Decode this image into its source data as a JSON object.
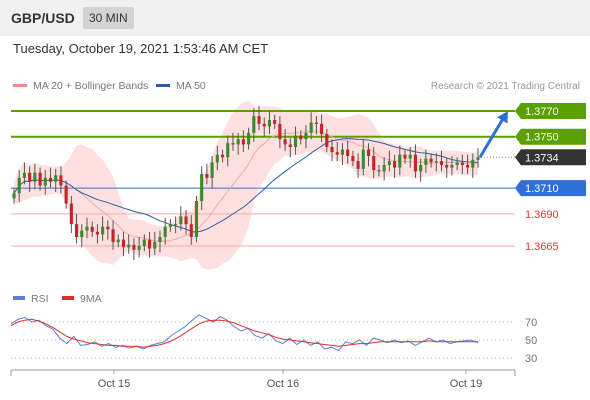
{
  "header": {
    "pair": "GBP/USD",
    "timeframe": "30 MIN"
  },
  "datetime": "Tuesday, October 19, 2021 1:53:46 AM CET",
  "legend": {
    "bollinger": {
      "label": "MA 20 + Bollinger Bands",
      "color": "#f08a8a"
    },
    "ma50": {
      "label": "MA 50",
      "color": "#2f5d9e"
    },
    "credit": "Research © 2021 Trading Central"
  },
  "rsi_legend": {
    "rsi": {
      "label": "RSI",
      "color": "#5b7fd6"
    },
    "ma9": {
      "label": "9MA",
      "color": "#e0302f"
    }
  },
  "chart_data": [
    {
      "type": "candlestick",
      "x_ticks": [
        "Oct 15",
        "Oct 16",
        "Oct 19"
      ],
      "last_price": 1.3734,
      "levels": [
        {
          "value": 1.377,
          "label": "1.3770",
          "kind": "resistance",
          "color": "#5aa000"
        },
        {
          "value": 1.375,
          "label": "1.3750",
          "kind": "resistance",
          "color": "#5aa000"
        },
        {
          "value": 1.3734,
          "label": "1.3734",
          "kind": "current",
          "color": "#333333"
        },
        {
          "value": 1.371,
          "label": "1.3710",
          "kind": "pivot",
          "color": "#2e6fd8"
        },
        {
          "value": 1.369,
          "label": "1.3690",
          "kind": "support",
          "color": "#e53935"
        },
        {
          "value": 1.3665,
          "label": "1.3665",
          "kind": "support",
          "color": "#e53935"
        }
      ],
      "projection": {
        "from": 1.3734,
        "to": 1.377,
        "color": "#2e6fd8"
      },
      "closes": [
        1.3706,
        1.3718,
        1.3722,
        1.3715,
        1.3722,
        1.3712,
        1.3718,
        1.3715,
        1.372,
        1.3712,
        1.3698,
        1.3682,
        1.3672,
        1.3677,
        1.368,
        1.3676,
        1.3674,
        1.368,
        1.3678,
        1.3668,
        1.367,
        1.3664,
        1.3666,
        1.3662,
        1.3665,
        1.367,
        1.3663,
        1.3668,
        1.3672,
        1.368,
        1.3682,
        1.3682,
        1.3688,
        1.3682,
        1.3672,
        1.37,
        1.3721,
        1.3718,
        1.373,
        1.3736,
        1.3734,
        1.3745,
        1.3744,
        1.3748,
        1.3744,
        1.3753,
        1.3766,
        1.376,
        1.3758,
        1.3763,
        1.376,
        1.3748,
        1.3744,
        1.3742,
        1.3751,
        1.3748,
        1.3753,
        1.3761,
        1.376,
        1.3752,
        1.3742,
        1.3738,
        1.3736,
        1.374,
        1.3735,
        1.3731,
        1.3725,
        1.374,
        1.3735,
        1.3724,
        1.3723,
        1.3728,
        1.3731,
        1.3726,
        1.3736,
        1.3733,
        1.3736,
        1.3723,
        1.3728,
        1.3733,
        1.373,
        1.3731,
        1.3728,
        1.3726,
        1.3728,
        1.373,
        1.3728,
        1.3726,
        1.3732,
        1.3734
      ]
    },
    {
      "type": "line",
      "name": "RSI panel",
      "y_ticks": [
        70,
        50,
        30
      ],
      "x_ticks": [
        "Oct 15",
        "Oct 16",
        "Oct 19"
      ],
      "series": [
        {
          "name": "RSI",
          "values": [
            68,
            73,
            75,
            70,
            72,
            66,
            62,
            52,
            46,
            54,
            44,
            45,
            48,
            43,
            46,
            42,
            44,
            41,
            43,
            40,
            44,
            46,
            48,
            55,
            60,
            65,
            72,
            78,
            74,
            70,
            76,
            72,
            65,
            60,
            63,
            55,
            52,
            57,
            49,
            46,
            52,
            45,
            50,
            44,
            48,
            40,
            42,
            38,
            48,
            46,
            50,
            44,
            52,
            50,
            47,
            50,
            47,
            49,
            44,
            48,
            52,
            48,
            50,
            46,
            48,
            49,
            50,
            47
          ]
        },
        {
          "name": "9MA",
          "values": [
            66,
            70,
            72,
            73,
            71,
            68,
            64,
            59,
            54,
            51,
            49,
            47,
            46,
            45,
            44,
            44,
            43,
            43,
            43,
            42,
            43,
            44,
            46,
            49,
            53,
            58,
            63,
            68,
            71,
            72,
            72,
            71,
            69,
            66,
            63,
            60,
            58,
            56,
            53,
            51,
            50,
            49,
            48,
            47,
            46,
            45,
            44,
            43,
            44,
            45,
            46,
            46,
            47,
            48,
            48,
            48,
            48,
            48,
            48,
            48,
            49,
            48,
            48,
            48,
            48,
            48,
            48,
            48
          ]
        }
      ]
    }
  ]
}
